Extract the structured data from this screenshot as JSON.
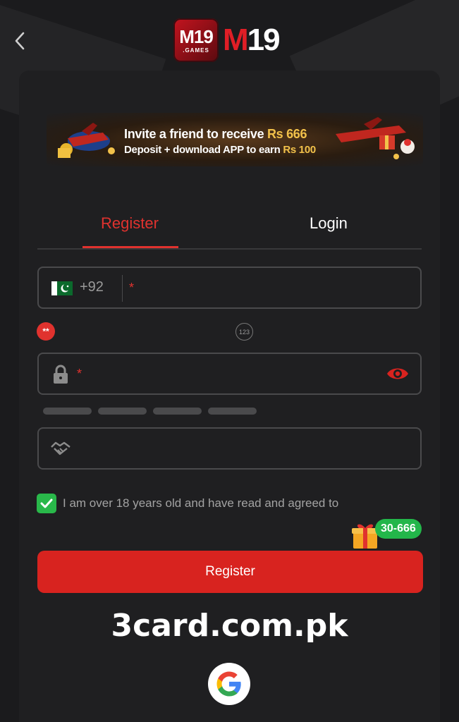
{
  "header": {
    "back_icon": "chevron-left-icon",
    "logo_badge_main": "M19",
    "logo_badge_sub": ".GAMES",
    "logo_text_m": "M",
    "logo_text_num": "19"
  },
  "banner": {
    "line1_text": "Invite a friend to receive",
    "line1_amount": "Rs 666",
    "line2_text": "Deposit + download APP to earn",
    "line2_amount": "Rs 100"
  },
  "tabs": [
    {
      "label": "Register",
      "active": true
    },
    {
      "label": "Login",
      "active": false
    }
  ],
  "form": {
    "phone": {
      "flag": "pakistan-flag-icon",
      "country_code": "+92",
      "required_mark": "*"
    },
    "error_badge": "**",
    "captcha_badge": "123",
    "password": {
      "icon": "lock-icon",
      "required_mark": "*",
      "toggle_icon": "eye-icon"
    },
    "invite": {
      "icon": "handshake-icon"
    },
    "agree_text": "I am over 18 years old and have read and agreed to",
    "gift_label": "30-666",
    "submit_label": "Register"
  },
  "watermark": "3card.com.pk",
  "social": {
    "google_icon": "google-icon"
  },
  "colors": {
    "accent": "#d8231f",
    "active_tab": "#e0322e",
    "checkbox": "#29b84a",
    "background": "#1b1b1d",
    "panel": "#1f1f21"
  }
}
